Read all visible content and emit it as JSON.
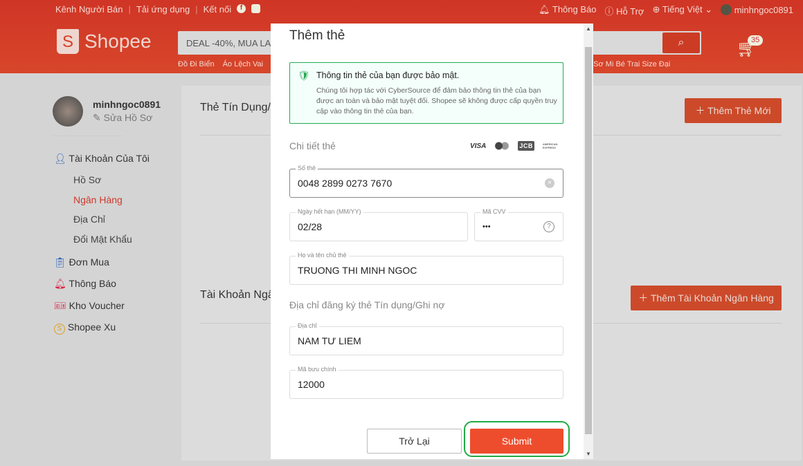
{
  "topbar": {
    "seller": "Kênh Người Bán",
    "app": "Tải ứng dụng",
    "connect": "Kết nối",
    "notifications": "Thông Báo",
    "help": "Hỗ Trợ",
    "language": "Tiếng Việt",
    "username": "minhngoc0891"
  },
  "header": {
    "logo": "Shopee",
    "search_placeholder": "DEAL -40%, MUA LA",
    "suggestions": [
      "Đồ Đi Biển",
      "Áo Lệch Vai",
      "o Sơ Mi Bé Trai Size Đại"
    ],
    "cart_count": "35"
  },
  "sidebar": {
    "username": "minhngoc0891",
    "edit_profile": "Sửa Hồ Sơ",
    "my_account": "Tài Khoản Của Tôi",
    "sub": [
      "Hồ Sơ",
      "Ngân Hàng",
      "Địa Chỉ",
      "Đổi Mật Khẩu"
    ],
    "items": [
      "Đơn Mua",
      "Thông Báo",
      "Kho Voucher",
      "Shopee Xu"
    ]
  },
  "main": {
    "cards_title": "Thẻ Tín Dụng/",
    "add_card": "Thêm Thẻ Mới",
    "bank_title": "Tài Khoản Ngâ",
    "add_bank": "Thêm Tài Khoản Ngân Hàng"
  },
  "modal": {
    "title": "Thêm thẻ",
    "secure_title": "Thông tin thẻ của bạn được bảo mật.",
    "secure_text": "Chúng tôi hợp tác với CyberSource để đảm bảo thông tin thẻ của bạn được an toàn và bảo mật tuyệt đối. Shopee sẽ không được cấp quyền truy cập vào thông tin thẻ của bạn.",
    "card_details": "Chi tiết thẻ",
    "brands": [
      "VISA",
      "mastercard",
      "JCB",
      "AMERICAN EXPRESS"
    ],
    "card_number": {
      "label": "Số thẻ",
      "value": "0048 2899 0273 7670"
    },
    "expiry": {
      "label": "Ngày hết hạn (MM/YY)",
      "value": "02/28"
    },
    "cvv": {
      "label": "Mã CVV",
      "value": "•••"
    },
    "name": {
      "label": "Họ và tên chủ thẻ",
      "value": "TRUONG THI MINH NGOC"
    },
    "address_section": "Địa chỉ đăng ký thẻ Tín dụng/Ghi nợ",
    "address": {
      "label": "Địa chỉ",
      "value": "NAM TƯ LIEM"
    },
    "postal": {
      "label": "Mã bưu chính",
      "value": "12000"
    },
    "back": "Trở Lại",
    "submit": "Submit"
  },
  "colors": {
    "brand": "#ee4d2d",
    "highlight": "#22aa44",
    "secure_border": "#26aa55"
  }
}
